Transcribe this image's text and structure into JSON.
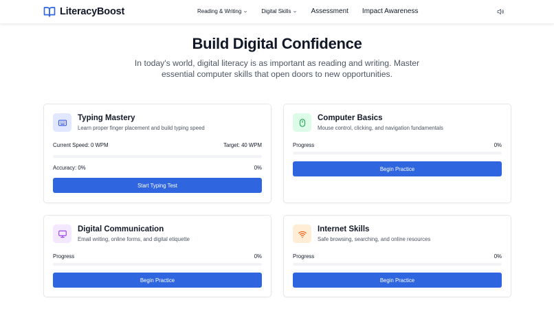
{
  "nav": {
    "brand": "LiteracyBoost",
    "links": [
      "Reading & Writing",
      "Digital Skills",
      "Assessment",
      "Impact Awareness"
    ]
  },
  "hero": {
    "title": "Build Digital Confidence",
    "subtitle": "In today's world, digital literacy is as important as reading and writing. Master essential computer skills that open doors to new opportunities."
  },
  "cards": {
    "typing": {
      "title": "Typing Mastery",
      "desc": "Learn proper finger placement and build typing speed",
      "speed_label": "Current Speed: 0 WPM",
      "target_label": "Target: 40 WPM",
      "accuracy_label": "Accuracy: 0%",
      "accuracy_value": "0%",
      "speed_progress": 0,
      "button": "Start Typing Test",
      "icon": "keyboard-icon",
      "color": "#3b5bdb",
      "icon_bg": "#e0e7ff"
    },
    "basics": {
      "title": "Computer Basics",
      "desc": "Mouse control, clicking, and navigation fundamentals",
      "progress_label": "Progress",
      "progress_value": "0%",
      "progress": 0,
      "button": "Begin Practice",
      "icon": "mouse-icon",
      "color": "#16a34a",
      "icon_bg": "#dcfce7"
    },
    "communication": {
      "title": "Digital Communication",
      "desc": "Email writing, online forms, and digital etiquette",
      "progress_label": "Progress",
      "progress_value": "0%",
      "progress": 0,
      "button": "Begin Practice",
      "icon": "monitor-icon",
      "color": "#9333ea",
      "icon_bg": "#f3e8ff"
    },
    "internet": {
      "title": "Internet Skills",
      "desc": "Safe browsing, searching, and online resources",
      "progress_label": "Progress",
      "progress_value": "0%",
      "progress": 0,
      "button": "Begin Practice",
      "icon": "wifi-icon",
      "color": "#ea580c",
      "icon_bg": "#ffedd5"
    }
  },
  "colors": {
    "accent": "#2f66e0",
    "text": "#111827",
    "muted": "#4b5563"
  }
}
